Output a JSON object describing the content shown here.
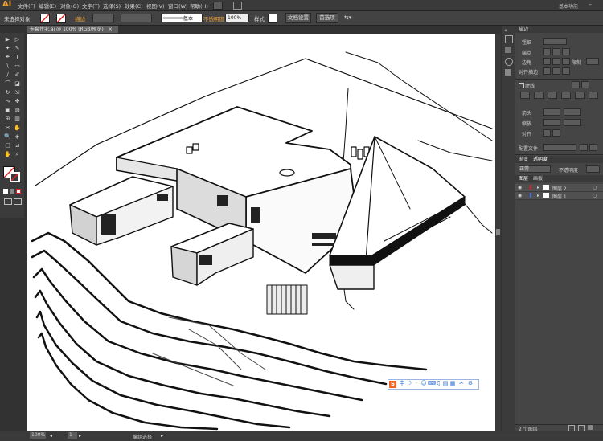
{
  "app": {
    "logo": "Ai",
    "workspace": "基本功能"
  },
  "menu": [
    "文件(F)",
    "编辑(E)",
    "对象(O)",
    "文字(T)",
    "选择(S)",
    "效果(C)",
    "视图(V)",
    "窗口(W)",
    "帮助(H)"
  ],
  "control": {
    "selection": "未选择对象",
    "stroke_label": "描边",
    "brush": "基本",
    "opacity_label": "不透明度",
    "opacity_value": "100%",
    "style_label": "样式",
    "doc_setup": "文档设置",
    "preferences": "首选项"
  },
  "document_tab": {
    "title": "卡套住宅.ai @ 100% (RGB/预览)",
    "close": "×"
  },
  "tools": [
    "▶",
    "▷",
    "✦",
    "✎",
    "✒",
    "T",
    "\\",
    "▭",
    "∕",
    "✐",
    "⌒",
    "◪",
    "↻",
    "⇲",
    "⤳",
    "✥",
    "▣",
    "◍",
    "⊞",
    "▥",
    "✂",
    "✋",
    "🔍",
    "◈"
  ],
  "stroke_panel": {
    "tab": "描边",
    "weight_label": "粗细",
    "cap_label": "端点",
    "corner_label": "边角",
    "limit_label": "限制",
    "align_label": "对齐描边",
    "dashed_label": "虚线",
    "arrow_label": "箭头",
    "scale_label": "缩放",
    "align2_label": "对齐",
    "profile_label": "配置文件"
  },
  "transparency_panel": {
    "tabs": [
      "渐变",
      "透明度"
    ],
    "mode": "正常",
    "opacity_label": "不透明度"
  },
  "layers_panel": {
    "tabs": [
      "图层",
      "画板"
    ],
    "layers": [
      {
        "name": "图层 2"
      },
      {
        "name": "图层 1"
      }
    ],
    "count": "2 个图层"
  },
  "status": {
    "zoom": "100%",
    "page": "1",
    "tool": "编组选择"
  },
  "ime_toolbar": {
    "logo": "S",
    "chars": [
      "中",
      "☽",
      "·",
      "☺",
      "⌨",
      "♫",
      "▤",
      "▦",
      "✂",
      "⚙"
    ]
  },
  "colors": {
    "fill": "#ffffff",
    "stroke": "#e02020",
    "accent": "#f0a030"
  }
}
